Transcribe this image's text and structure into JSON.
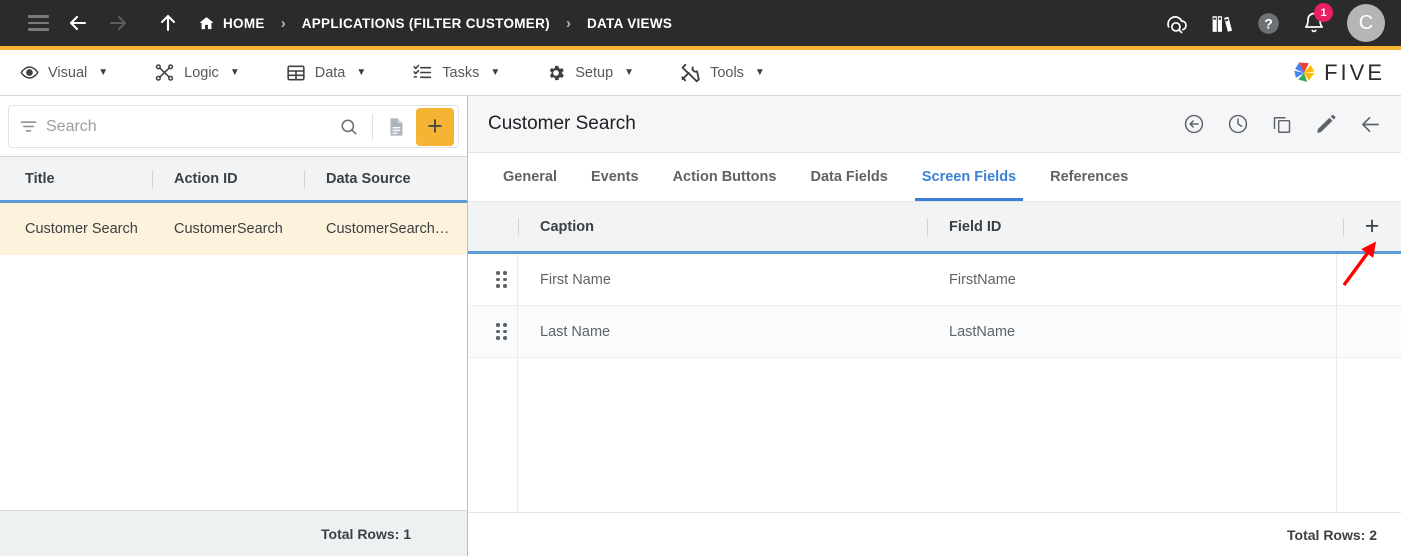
{
  "topbar": {
    "icons": [
      "hamburger-icon",
      "back-arrow-icon",
      "forward-arrow-icon",
      "up-arrow-icon"
    ],
    "breadcrumbs": [
      {
        "label": "HOME",
        "icon": "home-icon"
      },
      {
        "label": "APPLICATIONS (FILTER CUSTOMER)",
        "icon": ""
      },
      {
        "label": "DATA VIEWS",
        "icon": ""
      }
    ],
    "separator": "›",
    "right_icons": [
      "cloud-search-icon",
      "library-icon",
      "help-icon",
      "notification-bell-icon"
    ],
    "notification_count": "1",
    "avatar_initial": "C",
    "accent_color": "#f5b52b",
    "background_color": "#2b2b2b"
  },
  "menubar": {
    "items": [
      {
        "label": "Visual",
        "icon": "eye-icon",
        "caret": "▼"
      },
      {
        "label": "Logic",
        "icon": "logic-graph-icon",
        "caret": "▼"
      },
      {
        "label": "Data",
        "icon": "table-icon",
        "caret": "▼"
      },
      {
        "label": "Tasks",
        "icon": "checklist-icon",
        "caret": "▼"
      },
      {
        "label": "Setup",
        "icon": "gear-icon",
        "caret": "▼"
      },
      {
        "label": "Tools",
        "icon": "tools-icon",
        "caret": "▼"
      }
    ],
    "logo_text": "FIVE"
  },
  "left_panel": {
    "search": {
      "placeholder": "Search",
      "value": "",
      "filter_icon": "filter-icon",
      "search_icon": "magnifier-icon",
      "doc_icon": "document-icon",
      "add_label": "+",
      "add_color": "#f5b433"
    },
    "table": {
      "columns": [
        "Title",
        "Action ID",
        "Data Source"
      ],
      "rows": [
        {
          "title": "Customer Search",
          "action_id": "CustomerSearch",
          "data_source": "CustomerSearch…",
          "selected": true
        }
      ],
      "footer": "Total Rows: 1"
    }
  },
  "right_panel": {
    "title": "Customer Search",
    "actions": [
      "undo-icon",
      "history-clock-icon",
      "copy-icon",
      "edit-pencil-icon",
      "back-arrow-icon"
    ],
    "tabs": [
      {
        "label": "General",
        "active": false
      },
      {
        "label": "Events",
        "active": false
      },
      {
        "label": "Action Buttons",
        "active": false
      },
      {
        "label": "Data Fields",
        "active": false
      },
      {
        "label": "Screen Fields",
        "active": true
      },
      {
        "label": "References",
        "active": false
      }
    ],
    "grid": {
      "columns": [
        "Caption",
        "Field ID"
      ],
      "add_label": "+",
      "rows": [
        {
          "caption": "First Name",
          "field_id": "FirstName"
        },
        {
          "caption": "Last Name",
          "field_id": "LastName"
        }
      ],
      "footer": "Total Rows: 2"
    }
  },
  "annotation": {
    "type": "arrow",
    "color": "#ff0000",
    "points_to": "grid-add-row-button"
  }
}
